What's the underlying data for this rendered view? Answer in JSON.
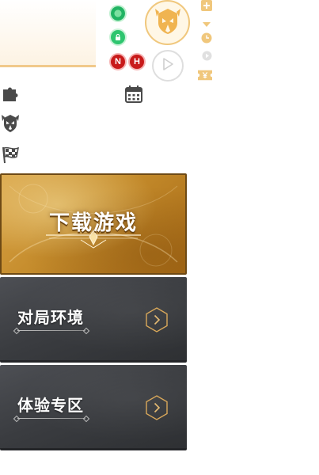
{
  "badges": {
    "n_label": "N",
    "h_label": "H"
  },
  "side_icons": [
    "plus-icon",
    "caret-down-icon",
    "clock-icon",
    "play-small-icon",
    "yen-ticket-icon"
  ],
  "menu_icons": [
    "puzzle-icon",
    "helmet-icon",
    "checkered-flag-icon",
    "calendar-icon"
  ],
  "cards": {
    "download": {
      "title": "下载游戏"
    },
    "match_environment": {
      "title": "对局环境"
    },
    "trial_zone": {
      "title": "体验专区"
    }
  },
  "colors": {
    "gold_accent": "#f0c77c",
    "green_status": "#21b463",
    "red_badge": "#c81a1a",
    "dark_card": "#3a3c40",
    "download_card": "#c58c2c"
  }
}
